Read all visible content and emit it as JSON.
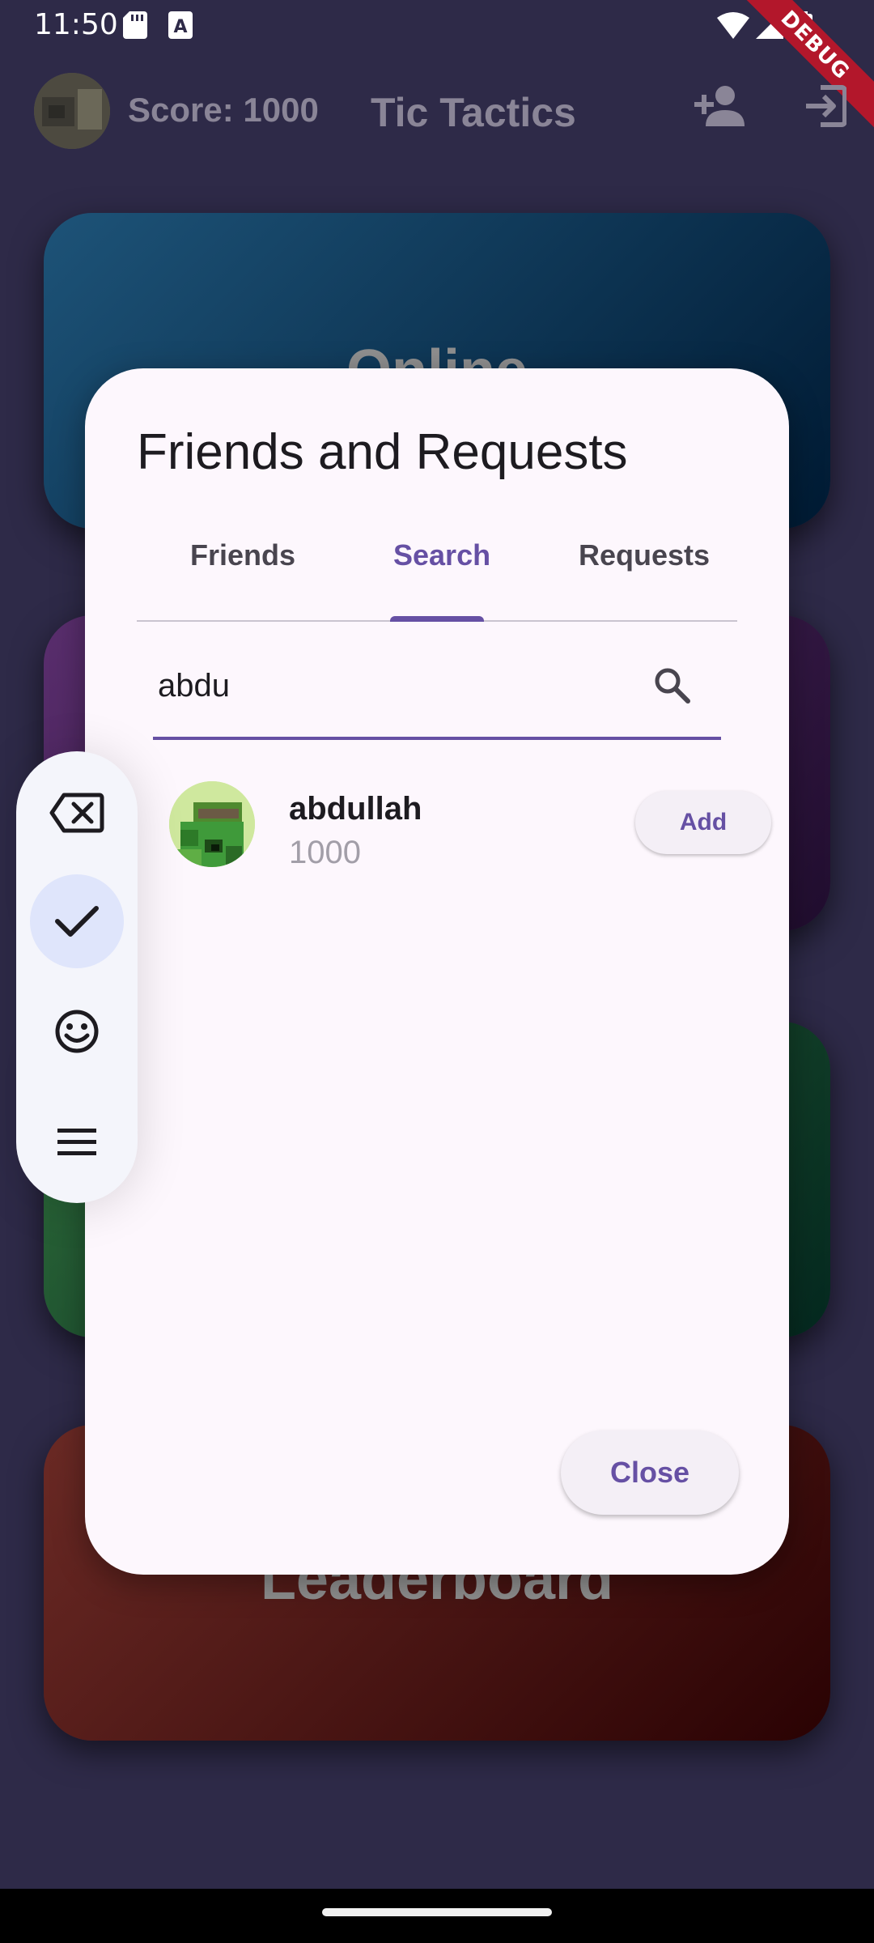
{
  "status_bar": {
    "time": "11:50",
    "debug_label": "DEBUG"
  },
  "appbar": {
    "score": "Score: 1000",
    "title": "Tic Tactics"
  },
  "background_cards": [
    {
      "label": "Online",
      "color_from": "#1d5378",
      "color_to": "#001a33"
    },
    {
      "label": "",
      "color_from": "#5a2e6e",
      "color_to": "#200d2e"
    },
    {
      "label": "",
      "color_from": "#2e6b3a",
      "color_to": "#04281f"
    },
    {
      "label": "Leaderboard",
      "color_from": "#6b2a25",
      "color_to": "#2a0203"
    }
  ],
  "dialog": {
    "title": "Friends and Requests",
    "tabs": [
      {
        "label": "Friends",
        "active": false
      },
      {
        "label": "Search",
        "active": true
      },
      {
        "label": "Requests",
        "active": false
      }
    ],
    "search": {
      "value": "abdu",
      "placeholder": ""
    },
    "results": [
      {
        "name": "abdullah",
        "score": "1000",
        "action": "Add"
      }
    ],
    "close_label": "Close"
  },
  "floating_toolbar": {
    "items": [
      {
        "icon": "backspace-icon",
        "selected": false
      },
      {
        "icon": "check-icon",
        "selected": true
      },
      {
        "icon": "emoji-icon",
        "selected": false
      },
      {
        "icon": "menu-icon",
        "selected": false
      }
    ]
  },
  "colors": {
    "accent": "#6650a4",
    "dialog_bg": "#fdf7fd",
    "app_bg": "#2e2a48"
  }
}
